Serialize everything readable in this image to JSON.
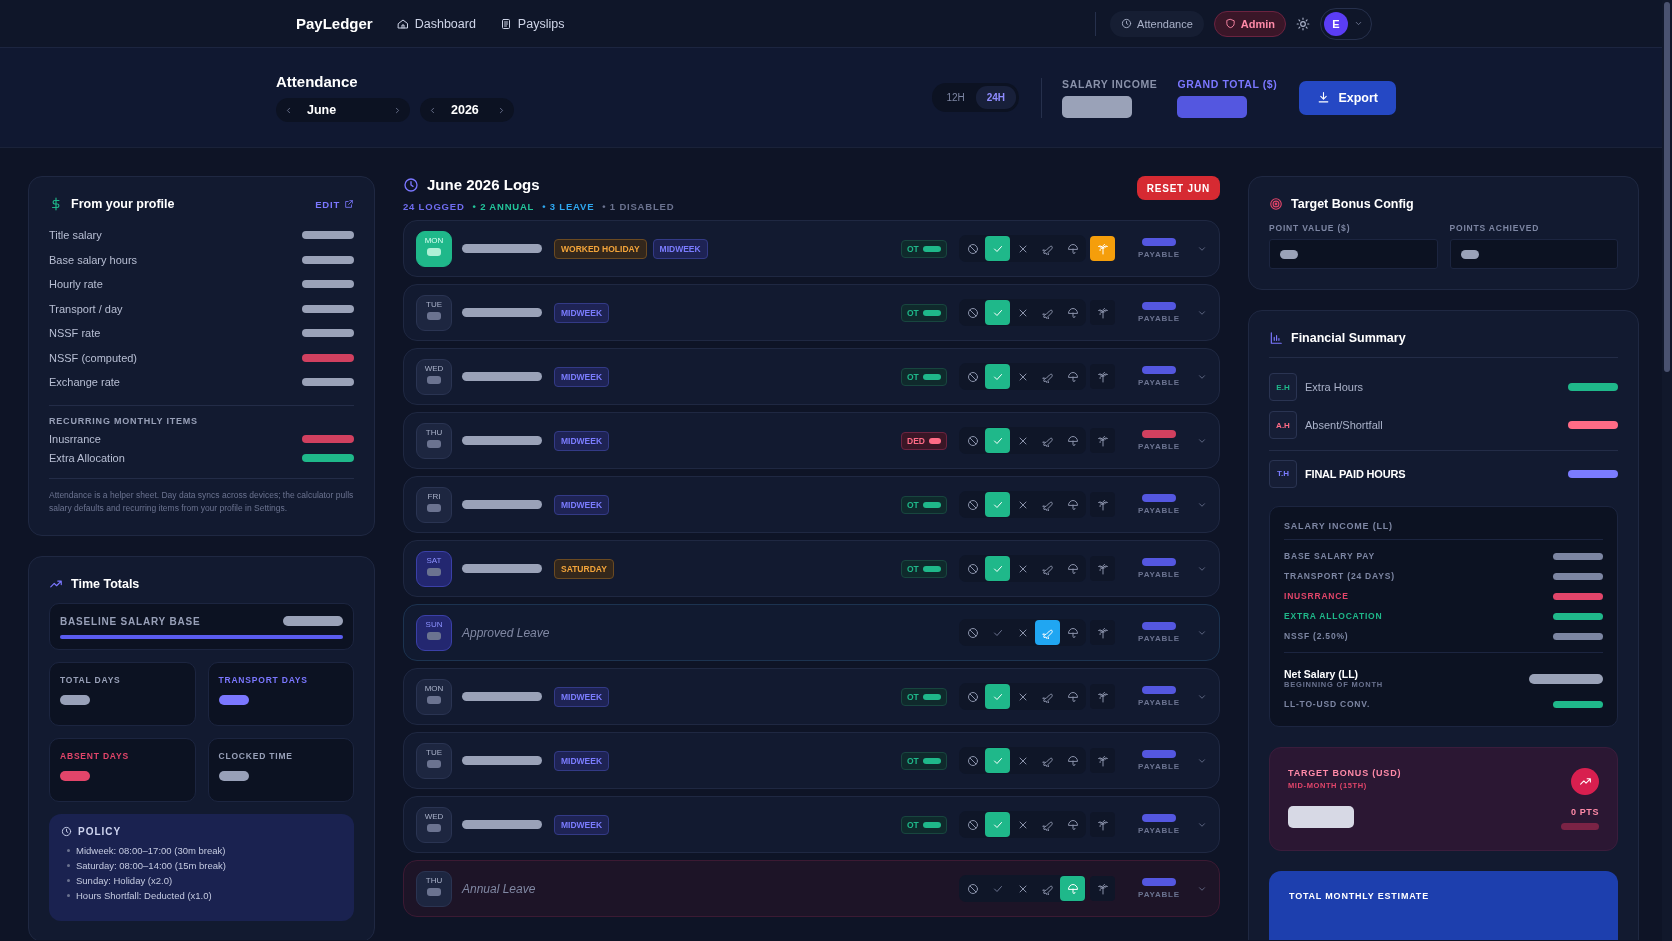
{
  "nav": {
    "brand": "PayLedger",
    "links": [
      {
        "label": "Dashboard"
      },
      {
        "label": "Payslips"
      }
    ],
    "chips": [
      {
        "label": "Attendance",
        "kind": "plain"
      },
      {
        "label": "Admin",
        "kind": "admin"
      }
    ],
    "avatar": "E"
  },
  "subheader": {
    "title": "Attendance",
    "month": "June",
    "year": "2026",
    "clock_modes": [
      {
        "label": "12H",
        "selected": false
      },
      {
        "label": "24H",
        "selected": true
      }
    ],
    "totals": [
      {
        "label": "SALARY INCOME",
        "kind": "plain"
      },
      {
        "label": "GRAND TOTAL ($)",
        "kind": "accent"
      }
    ],
    "export": "Export"
  },
  "profile": {
    "title": "From your profile",
    "edit": "EDIT",
    "rows": [
      {
        "label": "Title salary",
        "color": "#9aa2b8"
      },
      {
        "label": "Base salary hours",
        "color": "#9aa2b8"
      },
      {
        "label": "Hourly rate",
        "color": "#9aa2b8"
      },
      {
        "label": "Transport / day",
        "color": "#9aa2b8"
      },
      {
        "label": "NSSF rate",
        "color": "#9aa2b8"
      },
      {
        "label": "NSSF (computed)",
        "color": "#d1405f"
      },
      {
        "label": "Exchange rate",
        "color": "#9aa2b8"
      }
    ],
    "recurring_title": "RECURRING MONTHLY ITEMS",
    "recurring": [
      {
        "label": "Inusrrance",
        "color": "#d1405f"
      },
      {
        "label": "Extra Allocation",
        "color": "#1fb88a"
      }
    ],
    "note": "Attendance is a helper sheet. Day data syncs across devices; the calculator pulls salary defaults and recurring items from your profile in Settings."
  },
  "time_totals": {
    "title": "Time Totals",
    "baseline": {
      "label": "BASELINE SALARY BASE",
      "level": 1.0
    },
    "stats": [
      {
        "label": "TOTAL DAYS",
        "color": "#98a0b8"
      },
      {
        "label": "TRANSPORT DAYS",
        "color": "#7b77ff"
      },
      {
        "label": "ABSENT DAYS",
        "color": "#e2456a"
      },
      {
        "label": "CLOCKED TIME",
        "color": "#98a0b8"
      }
    ],
    "policy": {
      "title": "POLICY",
      "items": [
        "Midweek: 08:00–17:00 (30m break)",
        "Saturday: 08:00–14:00 (15m break)",
        "Sunday: Holiday (x2.0)",
        "Hours Shortfall: Deducted (x1.0)"
      ]
    }
  },
  "logs": {
    "title": "June 2026 Logs",
    "reset": "RESET JUN",
    "counts": [
      {
        "label": "24 LOGGED",
        "color": "#6f6cf0"
      },
      {
        "label": "• 2 ANNUAL",
        "color": "#22c59a"
      },
      {
        "label": "• 3 LEAVE",
        "color": "#2fa8f0"
      },
      {
        "label": "• 1 DISABLED",
        "color": "#6b7390"
      }
    ],
    "rows": [
      {
        "day": "MON",
        "today": true,
        "weekend": false,
        "kind": "normal",
        "tags": [
          {
            "label": "WORKED HOLIDAY",
            "kind": "holiday"
          },
          {
            "label": "MIDWEEK",
            "kind": "midweek"
          }
        ],
        "badge": {
          "label": "OT",
          "kind": "ot"
        },
        "actions": [
          {
            "kind": "disable",
            "on": false
          },
          {
            "kind": "present",
            "on": true
          },
          {
            "kind": "absent",
            "on": false
          },
          {
            "kind": "leave",
            "on": false
          },
          {
            "kind": "annual",
            "on": false
          },
          {
            "kind": "holiday",
            "on": true
          }
        ],
        "payable": "PAYABLE",
        "color": "#5457e0"
      },
      {
        "day": "TUE",
        "today": false,
        "weekend": false,
        "kind": "normal",
        "tags": [
          {
            "label": "MIDWEEK",
            "kind": "midweek"
          }
        ],
        "badge": {
          "label": "OT",
          "kind": "ot"
        },
        "actions": [
          {
            "kind": "disable",
            "on": false
          },
          {
            "kind": "present",
            "on": true
          },
          {
            "kind": "absent",
            "on": false
          },
          {
            "kind": "leave",
            "on": false
          },
          {
            "kind": "annual",
            "on": false
          },
          {
            "kind": "holiday",
            "on": false
          }
        ],
        "payable": "PAYABLE",
        "color": "#5457e0"
      },
      {
        "day": "WED",
        "today": false,
        "weekend": false,
        "kind": "normal",
        "tags": [
          {
            "label": "MIDWEEK",
            "kind": "midweek"
          }
        ],
        "badge": {
          "label": "OT",
          "kind": "ot"
        },
        "actions": [
          {
            "kind": "disable",
            "on": false
          },
          {
            "kind": "present",
            "on": true
          },
          {
            "kind": "absent",
            "on": false
          },
          {
            "kind": "leave",
            "on": false
          },
          {
            "kind": "annual",
            "on": false
          },
          {
            "kind": "holiday",
            "on": false
          }
        ],
        "payable": "PAYABLE",
        "color": "#5457e0"
      },
      {
        "day": "THU",
        "today": false,
        "weekend": false,
        "kind": "normal",
        "tags": [
          {
            "label": "MIDWEEK",
            "kind": "midweek"
          }
        ],
        "badge": {
          "label": "DED",
          "kind": "ded"
        },
        "actions": [
          {
            "kind": "disable",
            "on": false
          },
          {
            "kind": "present",
            "on": true
          },
          {
            "kind": "absent",
            "on": false
          },
          {
            "kind": "leave",
            "on": false
          },
          {
            "kind": "annual",
            "on": false
          },
          {
            "kind": "holiday",
            "on": false
          }
        ],
        "payable": "PAYABLE",
        "color": "#d1405f"
      },
      {
        "day": "FRI",
        "today": false,
        "weekend": false,
        "kind": "normal",
        "tags": [
          {
            "label": "MIDWEEK",
            "kind": "midweek"
          }
        ],
        "badge": {
          "label": "OT",
          "kind": "ot"
        },
        "actions": [
          {
            "kind": "disable",
            "on": false
          },
          {
            "kind": "present",
            "on": true
          },
          {
            "kind": "absent",
            "on": false
          },
          {
            "kind": "leave",
            "on": false
          },
          {
            "kind": "annual",
            "on": false
          },
          {
            "kind": "holiday",
            "on": false
          }
        ],
        "payable": "PAYABLE",
        "color": "#5457e0"
      },
      {
        "day": "SAT",
        "today": false,
        "weekend": true,
        "kind": "normal",
        "tags": [
          {
            "label": "SATURDAY",
            "kind": "saturday"
          }
        ],
        "badge": {
          "label": "OT",
          "kind": "ot"
        },
        "actions": [
          {
            "kind": "disable",
            "on": false
          },
          {
            "kind": "present",
            "on": true
          },
          {
            "kind": "absent",
            "on": false
          },
          {
            "kind": "leave",
            "on": false
          },
          {
            "kind": "annual",
            "on": false
          },
          {
            "kind": "holiday",
            "on": false
          }
        ],
        "payable": "PAYABLE",
        "color": "#5457e0"
      },
      {
        "day": "SUN",
        "today": false,
        "weekend": true,
        "kind": "leave",
        "note": "Approved Leave",
        "actions": [
          {
            "kind": "disable",
            "on": false
          },
          {
            "kind": "present",
            "on": false
          },
          {
            "kind": "absent",
            "on": false
          },
          {
            "kind": "leave",
            "on": true
          },
          {
            "kind": "annual",
            "on": false
          },
          {
            "kind": "holiday",
            "on": false
          }
        ],
        "payable": "PAYABLE",
        "color": "#5457e0"
      },
      {
        "day": "MON",
        "today": false,
        "weekend": false,
        "kind": "normal",
        "tags": [
          {
            "label": "MIDWEEK",
            "kind": "midweek"
          }
        ],
        "badge": {
          "label": "OT",
          "kind": "ot"
        },
        "actions": [
          {
            "kind": "disable",
            "on": false
          },
          {
            "kind": "present",
            "on": true
          },
          {
            "kind": "absent",
            "on": false
          },
          {
            "kind": "leave",
            "on": false
          },
          {
            "kind": "annual",
            "on": false
          },
          {
            "kind": "holiday",
            "on": false
          }
        ],
        "payable": "PAYABLE",
        "color": "#5457e0"
      },
      {
        "day": "TUE",
        "today": false,
        "weekend": false,
        "kind": "normal",
        "tags": [
          {
            "label": "MIDWEEK",
            "kind": "midweek"
          }
        ],
        "badge": {
          "label": "OT",
          "kind": "ot"
        },
        "actions": [
          {
            "kind": "disable",
            "on": false
          },
          {
            "kind": "present",
            "on": true
          },
          {
            "kind": "absent",
            "on": false
          },
          {
            "kind": "leave",
            "on": false
          },
          {
            "kind": "annual",
            "on": false
          },
          {
            "kind": "holiday",
            "on": false
          }
        ],
        "payable": "PAYABLE",
        "color": "#5457e0"
      },
      {
        "day": "WED",
        "today": false,
        "weekend": false,
        "kind": "normal",
        "tags": [
          {
            "label": "MIDWEEK",
            "kind": "midweek"
          }
        ],
        "badge": {
          "label": "OT",
          "kind": "ot"
        },
        "actions": [
          {
            "kind": "disable",
            "on": false
          },
          {
            "kind": "present",
            "on": true
          },
          {
            "kind": "absent",
            "on": false
          },
          {
            "kind": "leave",
            "on": false
          },
          {
            "kind": "annual",
            "on": false
          },
          {
            "kind": "holiday",
            "on": false
          }
        ],
        "payable": "PAYABLE",
        "color": "#5457e0"
      },
      {
        "day": "THU",
        "today": false,
        "weekend": false,
        "kind": "annual",
        "note": "Annual Leave",
        "actions": [
          {
            "kind": "disable",
            "on": false
          },
          {
            "kind": "present",
            "on": false
          },
          {
            "kind": "absent",
            "on": false
          },
          {
            "kind": "leave",
            "on": false
          },
          {
            "kind": "annual",
            "on": true
          },
          {
            "kind": "holiday",
            "on": false
          }
        ],
        "payable": "PAYABLE",
        "color": "#5457e0"
      }
    ]
  },
  "bonus_config": {
    "title": "Target Bonus Config",
    "fields": [
      {
        "label": "POINT VALUE ($)"
      },
      {
        "label": "POINTS ACHIEVED"
      }
    ]
  },
  "summary": {
    "title": "Financial Summary",
    "hours": [
      {
        "code": "E.H",
        "label": "Extra Hours",
        "color": "#1fb88a"
      },
      {
        "code": "A.H",
        "label": "Absent/Shortfall",
        "color": "#ff6b86"
      },
      {
        "code": "T.H",
        "label": "FINAL PAID HOURS",
        "color": "#7b7cff"
      }
    ],
    "income": {
      "title": "SALARY INCOME (LL)",
      "lines": [
        {
          "label": "BASE SALARY PAY",
          "color": "#7d86a3"
        },
        {
          "label": "TRANSPORT (24 DAYS)",
          "color": "#7d86a3"
        },
        {
          "label": "INUSRRANCE",
          "color": "#e2456a"
        },
        {
          "label": "EXTRA ALLOCATION",
          "color": "#1fb88a"
        },
        {
          "label": "NSSF (2.50%)",
          "color": "#7d86a3"
        }
      ],
      "net": {
        "label": "Net Salary (LL)",
        "sub": "BEGINNING OF MONTH"
      },
      "conv": {
        "label": "LL-TO-USD CONV.",
        "color": "#1fb88a"
      }
    },
    "bonus": {
      "title": "TARGET BONUS (USD)",
      "sub": "MID-MONTH (15TH)",
      "points": "0 PTS"
    },
    "estimate": {
      "title": "TOTAL MONTHLY ESTIMATE"
    }
  }
}
